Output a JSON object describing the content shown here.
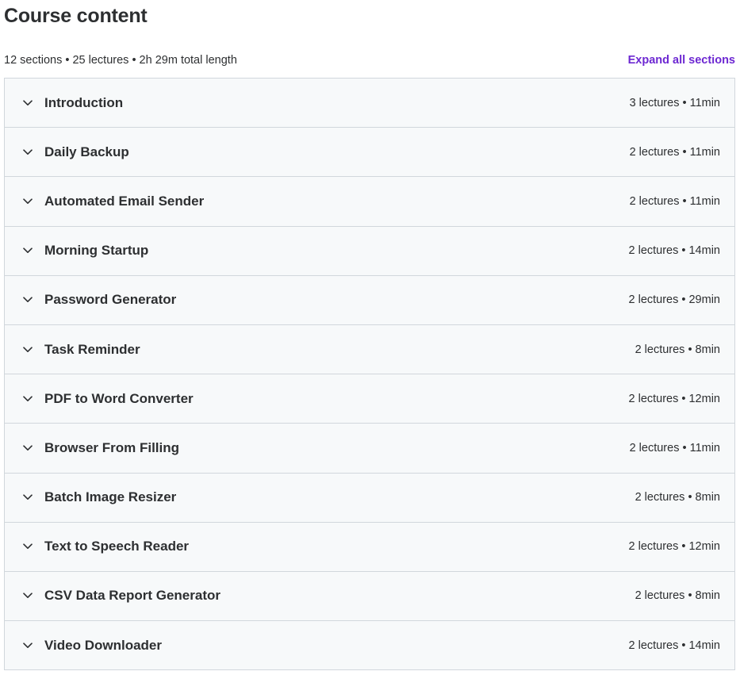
{
  "header": {
    "title": "Course content",
    "summary": "12 sections • 25 lectures • 2h 29m total length",
    "expand_label": "Expand all sections"
  },
  "colors": {
    "accent": "#6d28d2",
    "row_background": "#f7f9fa",
    "border": "#d1d7dc",
    "text": "#2d2f31"
  },
  "sections": [
    {
      "title": "Introduction",
      "meta": "3 lectures • 11min"
    },
    {
      "title": "Daily Backup",
      "meta": "2 lectures • 11min"
    },
    {
      "title": "Automated Email Sender",
      "meta": "2 lectures • 11min"
    },
    {
      "title": "Morning Startup",
      "meta": "2 lectures • 14min"
    },
    {
      "title": "Password Generator",
      "meta": "2 lectures • 29min"
    },
    {
      "title": "Task Reminder",
      "meta": "2 lectures • 8min"
    },
    {
      "title": "PDF to Word Converter",
      "meta": "2 lectures • 12min"
    },
    {
      "title": "Browser From Filling",
      "meta": "2 lectures • 11min"
    },
    {
      "title": "Batch Image Resizer",
      "meta": "2 lectures • 8min"
    },
    {
      "title": "Text to Speech Reader",
      "meta": "2 lectures • 12min"
    },
    {
      "title": "CSV Data Report Generator",
      "meta": "2 lectures • 8min"
    },
    {
      "title": "Video Downloader",
      "meta": "2 lectures • 14min"
    }
  ]
}
